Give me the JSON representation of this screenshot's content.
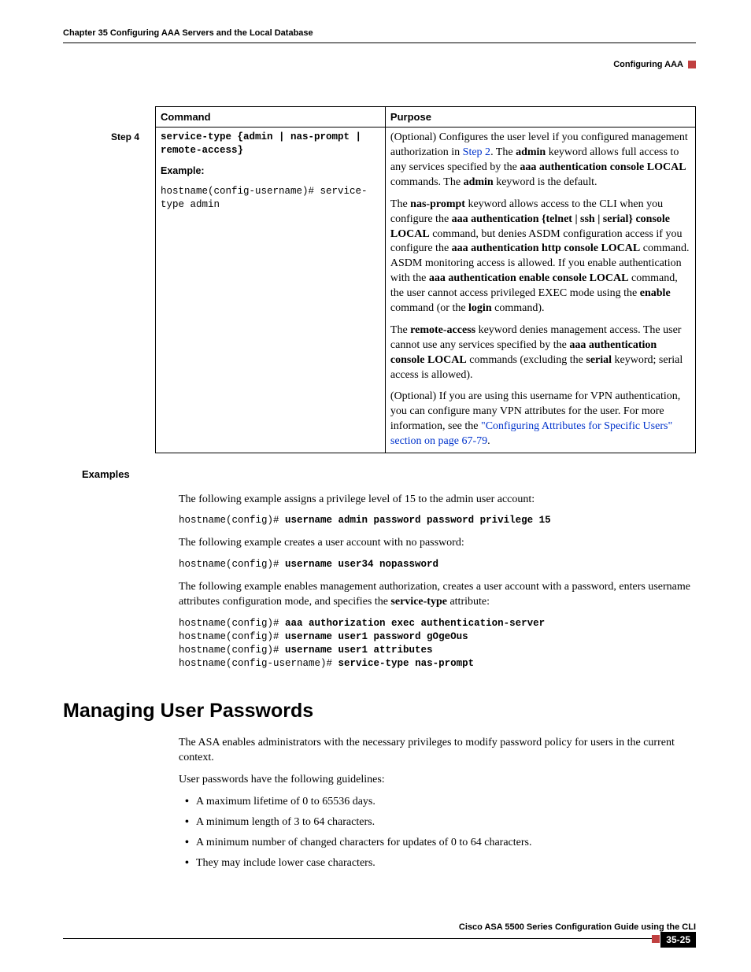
{
  "header": {
    "left": "Chapter 35    Configuring AAA Servers and the Local Database",
    "right": "Configuring AAA"
  },
  "table": {
    "head": {
      "c1": "Command",
      "c2": "Purpose"
    },
    "step": "Step 4",
    "cmd_syntax": "service-type {admin | nas-prompt | remote-access}",
    "example_label": "Example:",
    "example_code": "hostname(config-username)# service-type admin",
    "p1_a": "(Optional) Configures the user level if you configured management authorization in ",
    "p1_link": "Step 2",
    "p1_b": ". The ",
    "p1_kw1": "admin",
    "p1_c": " keyword allows full access to any services specified by the ",
    "p1_kw2": "aaa authentication console LOCAL",
    "p1_d": " commands. The ",
    "p1_kw3": "admin",
    "p1_e": " keyword is the default.",
    "p2_a": "The ",
    "p2_kw1": "nas-prompt",
    "p2_b": " keyword allows access to the CLI when you configure the ",
    "p2_kw2": "aaa authentication {telnet | ssh | serial} console LOCAL",
    "p2_c": " command, but denies ASDM configuration access if you configure the ",
    "p2_kw3": "aaa authentication http console LOCAL",
    "p2_d": " command. ASDM monitoring access is allowed. If you enable authentication with the ",
    "p2_kw4": "aaa authentication enable console LOCAL",
    "p2_e": " command, the user cannot access privileged EXEC mode using the ",
    "p2_kw5": "enable",
    "p2_f": " command (or the ",
    "p2_kw6": "login",
    "p2_g": " command).",
    "p3_a": "The ",
    "p3_kw1": "remote-access",
    "p3_b": " keyword denies management access. The user cannot use any services specified by the ",
    "p3_kw2": "aaa authentication console LOCAL",
    "p3_c": " commands (excluding the ",
    "p3_kw3": "serial",
    "p3_d": " keyword; serial access is allowed).",
    "p4_a": "(Optional) If you are using this username for VPN authentication, you can configure many VPN attributes for the user. For more information, see the ",
    "p4_link": "\"Configuring Attributes for Specific Users\" section on page 67-79",
    "p4_b": "."
  },
  "examples": {
    "label": "Examples",
    "p1": "The following example assigns a privilege level of 15 to the admin user account:",
    "c1_pre": "hostname(config)# ",
    "c1_bold": "username admin password password privilege 15",
    "p2": "The following example creates a user account with no password:",
    "c2_pre": "hostname(config)# ",
    "c2_bold": "username user34 nopassword",
    "p3_a": "The following example enables management authorization, creates a user account with a password, enters username attributes configuration mode, and specifies the ",
    "p3_kw": "service-type",
    "p3_b": " attribute:",
    "c3_l1p": "hostname(config)# ",
    "c3_l1b": "aaa authorization exec authentication-server",
    "c3_l2p": "hostname(config)# ",
    "c3_l2b": "username user1 password gOgeOus",
    "c3_l3p": "hostname(config)# ",
    "c3_l3b": "username user1 attributes",
    "c3_l4p": "hostname(config-username)# ",
    "c3_l4b": "service-type nas-prompt"
  },
  "manage": {
    "h1": "Managing User Passwords",
    "p1": "The ASA enables administrators with the necessary privileges to modify password policy for users in the current context.",
    "p2": "User passwords have the following guidelines:",
    "li1": "A maximum lifetime of 0 to 65536 days.",
    "li2": "A minimum length of 3 to 64 characters.",
    "li3": "A minimum number of changed characters for updates of 0 to 64 characters.",
    "li4": "They may include lower case characters."
  },
  "footer": {
    "title": "Cisco ASA 5500 Series Configuration Guide using the CLI",
    "page": "35-25"
  }
}
